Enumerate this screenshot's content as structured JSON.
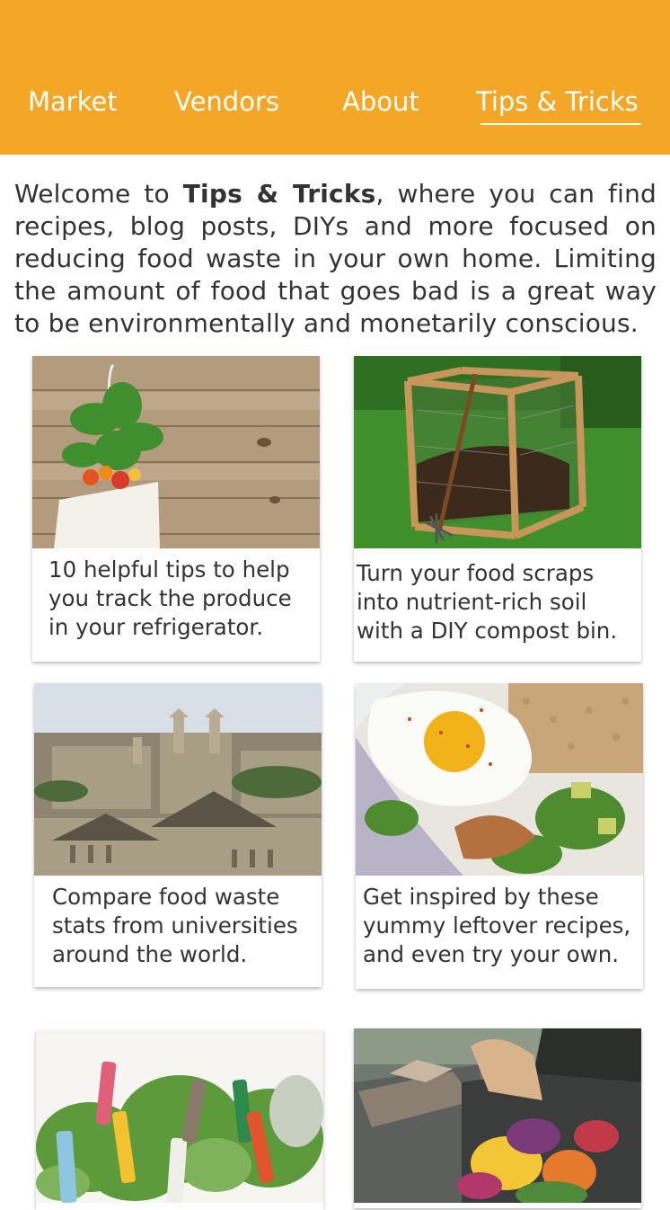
{
  "nav": {
    "items": [
      {
        "label": "Market"
      },
      {
        "label": "Vendors"
      },
      {
        "label": "About"
      },
      {
        "label": "Tips & Tricks"
      }
    ],
    "active": "Tips & Tricks"
  },
  "intro": {
    "prefix": "Welcome to",
    "bold": "Tips & Tricks",
    "suffix_lines": [
      ", where you can find",
      "recipes, blog posts, DIYs and more focused on",
      "reducing food waste in your own home. Limiting",
      "the amount of food that goes bad is a great way",
      "to be environmentally and monetarily conscious."
    ]
  },
  "cards": [
    {
      "caption_lines": [
        "10 helpful tips to help",
        "you track the produce",
        "in your refrigerator."
      ],
      "image": "produce-bag-on-wood-image"
    },
    {
      "caption_lines": [
        "Turn your food scraps",
        "into nutrient-rich soil",
        "with a DIY compost bin."
      ],
      "image": "compost-bin-image"
    },
    {
      "caption_lines": [
        "Compare food waste",
        "stats from universities",
        "around the world."
      ],
      "image": "university-skyline-image"
    },
    {
      "caption_lines": [
        "Get inspired by these",
        "yummy leftover recipes,",
        "and even try your own."
      ],
      "image": "leftover-bowl-image"
    },
    {
      "caption_lines": [],
      "image": "herb-garden-image"
    },
    {
      "caption_lines": [],
      "image": "food-waste-bins-image"
    }
  ],
  "colors": {
    "header": "#f4a626",
    "header_text": "#ffffff"
  }
}
